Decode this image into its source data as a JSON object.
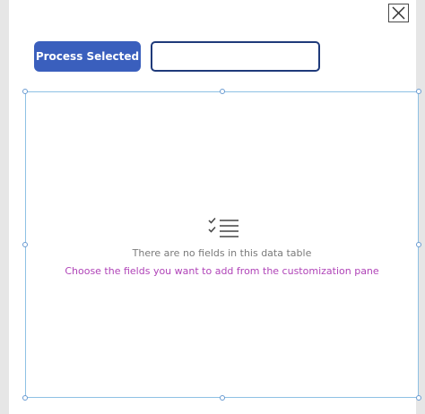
{
  "toolbar": {
    "process_label": "Process Selected",
    "input_value": "",
    "input_placeholder": ""
  },
  "data_table": {
    "empty_title": "There are no fields in this data table",
    "empty_hint": "Choose the fields you want to add from the customization pane",
    "empty_icon": "checklist-icon"
  },
  "dialog": {
    "close_icon": "close-icon"
  },
  "colors": {
    "accent": "#3a5fbd",
    "input_border": "#1f3a7a",
    "selection_border": "#8ec1e4",
    "hint_text": "#b044b8",
    "muted_text": "#7a7a7a"
  }
}
